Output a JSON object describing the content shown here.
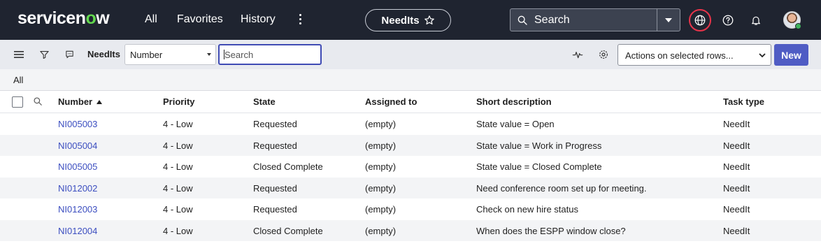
{
  "nav": {
    "logo_prefix": "servicen",
    "logo_o": "o",
    "logo_suffix": "w",
    "items": [
      "All",
      "Favorites",
      "History"
    ],
    "pill_label": "NeedIts",
    "search_placeholder": "Search"
  },
  "toolbar": {
    "list_title": "NeedIts",
    "field_select_value": "Number",
    "search_placeholder": "Search",
    "actions_label": "Actions on selected rows...",
    "new_label": "New"
  },
  "breadcrumb": "All",
  "table": {
    "columns": [
      "Number",
      "Priority",
      "State",
      "Assigned to",
      "Short description",
      "Task type"
    ],
    "rows": [
      [
        "NI005003",
        "4 - Low",
        "Requested",
        "(empty)",
        "State value = Open",
        "NeedIt"
      ],
      [
        "NI005004",
        "4 - Low",
        "Requested",
        "(empty)",
        "State value = Work in Progress",
        "NeedIt"
      ],
      [
        "NI005005",
        "4 - Low",
        "Closed Complete",
        "(empty)",
        "State value = Closed Complete",
        "NeedIt"
      ],
      [
        "NI012002",
        "4 - Low",
        "Requested",
        "(empty)",
        "Need conference room set up for meeting.",
        "NeedIt"
      ],
      [
        "NI012003",
        "4 - Low",
        "Requested",
        "(empty)",
        "Check on new hire status",
        "NeedIt"
      ],
      [
        "NI012004",
        "4 - Low",
        "Closed Complete",
        "(empty)",
        "When does the ESPP window close?",
        "NeedIt"
      ]
    ]
  },
  "colors": {
    "nav_bg": "#1f2430",
    "accent": "#4f5cc4",
    "link": "#3c4ec0",
    "logo_o": "#62d84e",
    "alert_ring": "#e8344a"
  },
  "icons": [
    "more-vertical-icon",
    "star-icon",
    "search-icon",
    "chevron-down-icon",
    "globe-icon",
    "help-icon",
    "bell-icon",
    "hamburger-icon",
    "filter-icon",
    "comment-icon",
    "activity-icon",
    "gear-icon",
    "sort-asc-icon"
  ]
}
